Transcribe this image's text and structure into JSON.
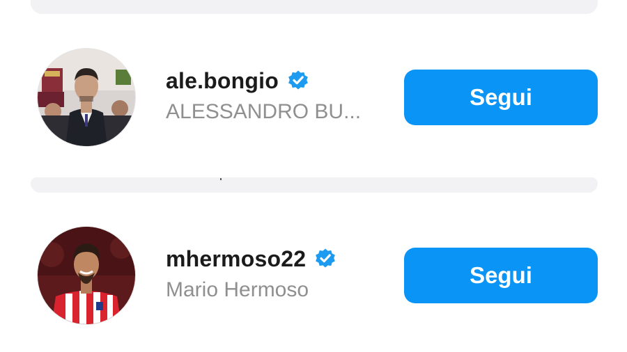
{
  "suggestions": [
    {
      "username": "ale.bongio",
      "full_name": "ALESSANDRO BU...",
      "verified": true,
      "verified_icon": "verified-badge-icon",
      "avatar_icon": "profile-photo",
      "follow_label": "Segui"
    },
    {
      "username": "mhermoso22",
      "full_name": "Mario Hermoso",
      "verified": true,
      "verified_icon": "verified-badge-icon",
      "avatar_icon": "profile-photo",
      "follow_label": "Segui"
    }
  ],
  "colors": {
    "accent": "#0a95f6",
    "verified": "#1d9bf0",
    "secondary_text": "#8f8f8f",
    "primary_text": "#1b1b1b",
    "card_background": "#f2f2f4"
  }
}
